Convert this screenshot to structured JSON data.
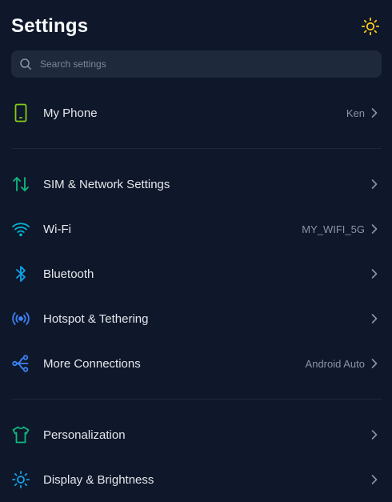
{
  "header": {
    "title": "Settings",
    "theme_icon": "sun-icon"
  },
  "search": {
    "placeholder": "Search settings",
    "value": ""
  },
  "colors": {
    "background": "#0f172a",
    "search_bg": "#1e293b",
    "sun": "#facc15",
    "phone": "#84cc16",
    "sim": "#10b981",
    "wifi": "#06b6d4",
    "bluetooth": "#0ea5e9",
    "hotspot": "#3b82f6",
    "connections": "#3b82f6",
    "personalization": "#10b981",
    "display": "#0ea5e9"
  },
  "sections": [
    {
      "items": [
        {
          "label": "My Phone",
          "value": "Ken",
          "icon": "phone-icon"
        }
      ]
    },
    {
      "items": [
        {
          "label": "SIM & Network Settings",
          "value": "",
          "icon": "sim-network-icon"
        },
        {
          "label": "Wi-Fi",
          "value": "MY_WIFI_5G",
          "icon": "wifi-icon"
        },
        {
          "label": "Bluetooth",
          "value": "",
          "icon": "bluetooth-icon"
        },
        {
          "label": "Hotspot & Tethering",
          "value": "",
          "icon": "hotspot-icon"
        },
        {
          "label": "More Connections",
          "value": "Android Auto",
          "icon": "connections-icon"
        }
      ]
    },
    {
      "items": [
        {
          "label": "Personalization",
          "value": "",
          "icon": "tshirt-icon"
        },
        {
          "label": "Display & Brightness",
          "value": "",
          "icon": "brightness-icon"
        }
      ]
    }
  ]
}
